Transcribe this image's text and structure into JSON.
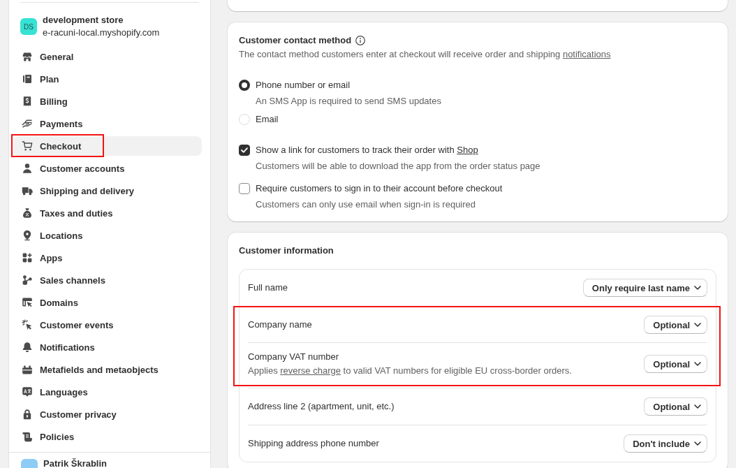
{
  "sidebar": {
    "store": {
      "initials": "DS",
      "name": "development store",
      "domain": "e-racuni-local.myshopify.com"
    },
    "items": [
      {
        "label": "General",
        "selected": false,
        "highlighted": false
      },
      {
        "label": "Plan",
        "selected": false,
        "highlighted": false
      },
      {
        "label": "Billing",
        "selected": false,
        "highlighted": false
      },
      {
        "label": "Payments",
        "selected": false,
        "highlighted": false
      },
      {
        "label": "Checkout",
        "selected": true,
        "highlighted": true
      },
      {
        "label": "Customer accounts",
        "selected": false,
        "highlighted": false
      },
      {
        "label": "Shipping and delivery",
        "selected": false,
        "highlighted": false
      },
      {
        "label": "Taxes and duties",
        "selected": false,
        "highlighted": false
      },
      {
        "label": "Locations",
        "selected": false,
        "highlighted": false
      },
      {
        "label": "Apps",
        "selected": false,
        "highlighted": false
      },
      {
        "label": "Sales channels",
        "selected": false,
        "highlighted": false
      },
      {
        "label": "Domains",
        "selected": false,
        "highlighted": false
      },
      {
        "label": "Customer events",
        "selected": false,
        "highlighted": false
      },
      {
        "label": "Notifications",
        "selected": false,
        "highlighted": false
      },
      {
        "label": "Metafields and metaobjects",
        "selected": false,
        "highlighted": false
      },
      {
        "label": "Languages",
        "selected": false,
        "highlighted": false
      },
      {
        "label": "Customer privacy",
        "selected": false,
        "highlighted": false
      },
      {
        "label": "Policies",
        "selected": false,
        "highlighted": false
      }
    ],
    "user": {
      "name": "Patrik Škrablin"
    }
  },
  "contact_method": {
    "title": "Customer contact method",
    "description": [
      {
        "kind": "text",
        "text": "The contact method customers enter at checkout will receive order and shipping "
      },
      {
        "kind": "link",
        "text": "notifications"
      }
    ],
    "options": [
      {
        "label": "Phone number or email",
        "help": "An SMS App is required to send SMS updates",
        "selected": true
      },
      {
        "label": "Email",
        "selected": false
      }
    ],
    "settings": [
      {
        "label": [
          {
            "kind": "text",
            "text": "Show a link for customers to track their order with "
          },
          {
            "kind": "link",
            "text": "Shop"
          }
        ],
        "help": "Customers will be able to download the app from the order status page",
        "checked": true
      },
      {
        "label": [
          {
            "kind": "text",
            "text": "Require customers to sign in to their account before checkout"
          }
        ],
        "help": "Customers can only use email when sign-in is required",
        "checked": false
      }
    ]
  },
  "customer_information": {
    "title": "Customer information",
    "fields": [
      {
        "label": "Full name",
        "value": "Only require last name",
        "highlighted": false
      },
      {
        "label": "Company name",
        "value": "Optional",
        "highlighted": true
      },
      {
        "label": "Company VAT number",
        "description": [
          {
            "kind": "text",
            "text": "Applies "
          },
          {
            "kind": "link",
            "text": "reverse charge"
          },
          {
            "kind": "text",
            "text": " to valid VAT numbers for eligible EU cross-border orders."
          }
        ],
        "value": "Optional",
        "highlighted": true
      },
      {
        "label": "Address line 2 (apartment, unit, etc.)",
        "value": "Optional",
        "highlighted": false
      },
      {
        "label": "Shipping address phone number",
        "value": "Don't include",
        "highlighted": false
      }
    ]
  }
}
